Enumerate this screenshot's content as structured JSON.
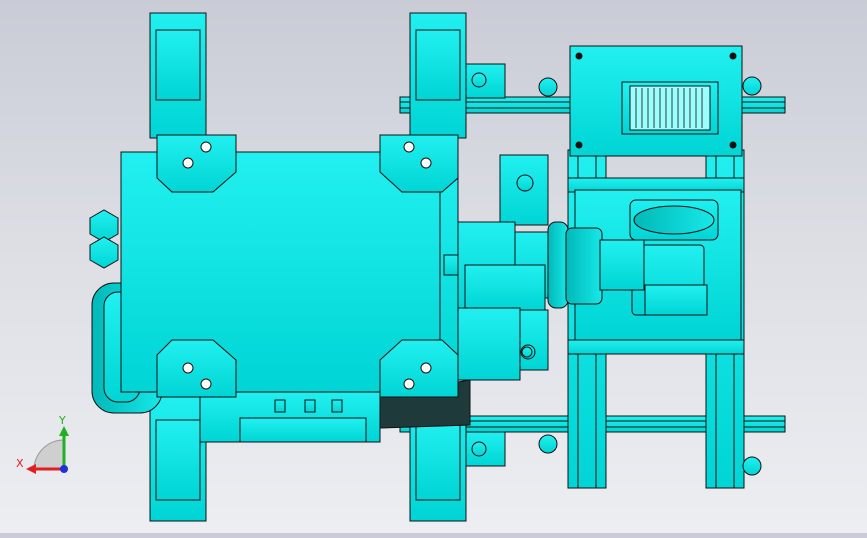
{
  "scene": {
    "background_top": "#c9ccd6",
    "background_bottom": "#eceef2",
    "part_color": "#00e6e6",
    "part_shadow": "#00b8b8",
    "edge_color": "#111111",
    "dark_part_color": "#1e3a3a"
  },
  "triad": {
    "x_label": "X",
    "y_label": "Y",
    "x_color": "#e02020",
    "y_color": "#20b020",
    "z_color": "#2030e0"
  }
}
